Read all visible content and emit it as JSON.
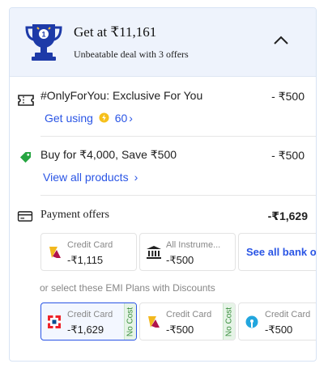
{
  "header": {
    "title": "Get at  ₹11,161",
    "subtitle": "Unbeatable deal with 3 offers"
  },
  "offers": [
    {
      "title": "#OnlyForYou: Exclusive For You",
      "amount": "- ₹500",
      "link_label": "Get using",
      "coins": "60",
      "link_suffix": "›"
    },
    {
      "title": "Buy for ₹4,000, Save ₹500",
      "amount": "- ₹500",
      "link_label": "View all products",
      "link_suffix": "›"
    }
  ],
  "payment": {
    "title": "Payment offers",
    "amount": "-₹1,629",
    "tiles": [
      {
        "label": "Credit Card",
        "value": "-₹1,115",
        "icon": "axis-bank-logo"
      },
      {
        "label": "All Instrume...",
        "value": "-₹500",
        "icon": "bank-icon"
      }
    ],
    "see_all_label": "See all bank o",
    "emi_caption": "or select these EMI Plans with Discounts",
    "emi_tiles": [
      {
        "label": "Credit Card",
        "value": "-₹1,629",
        "badge": "No Cost",
        "icon": "hdfc-bank-logo",
        "selected": true
      },
      {
        "label": "Credit Card",
        "value": "-₹500",
        "badge": "No Cost",
        "icon": "axis-bank-logo",
        "selected": false
      },
      {
        "label": "Credit Card",
        "value": "-₹500",
        "icon": "sbi-bank-logo",
        "selected": false
      }
    ]
  },
  "colors": {
    "header_bg": "#eef3fc",
    "link": "#2a55e5",
    "no_cost_green": "#388e3c",
    "tag_green": "#26a541"
  }
}
